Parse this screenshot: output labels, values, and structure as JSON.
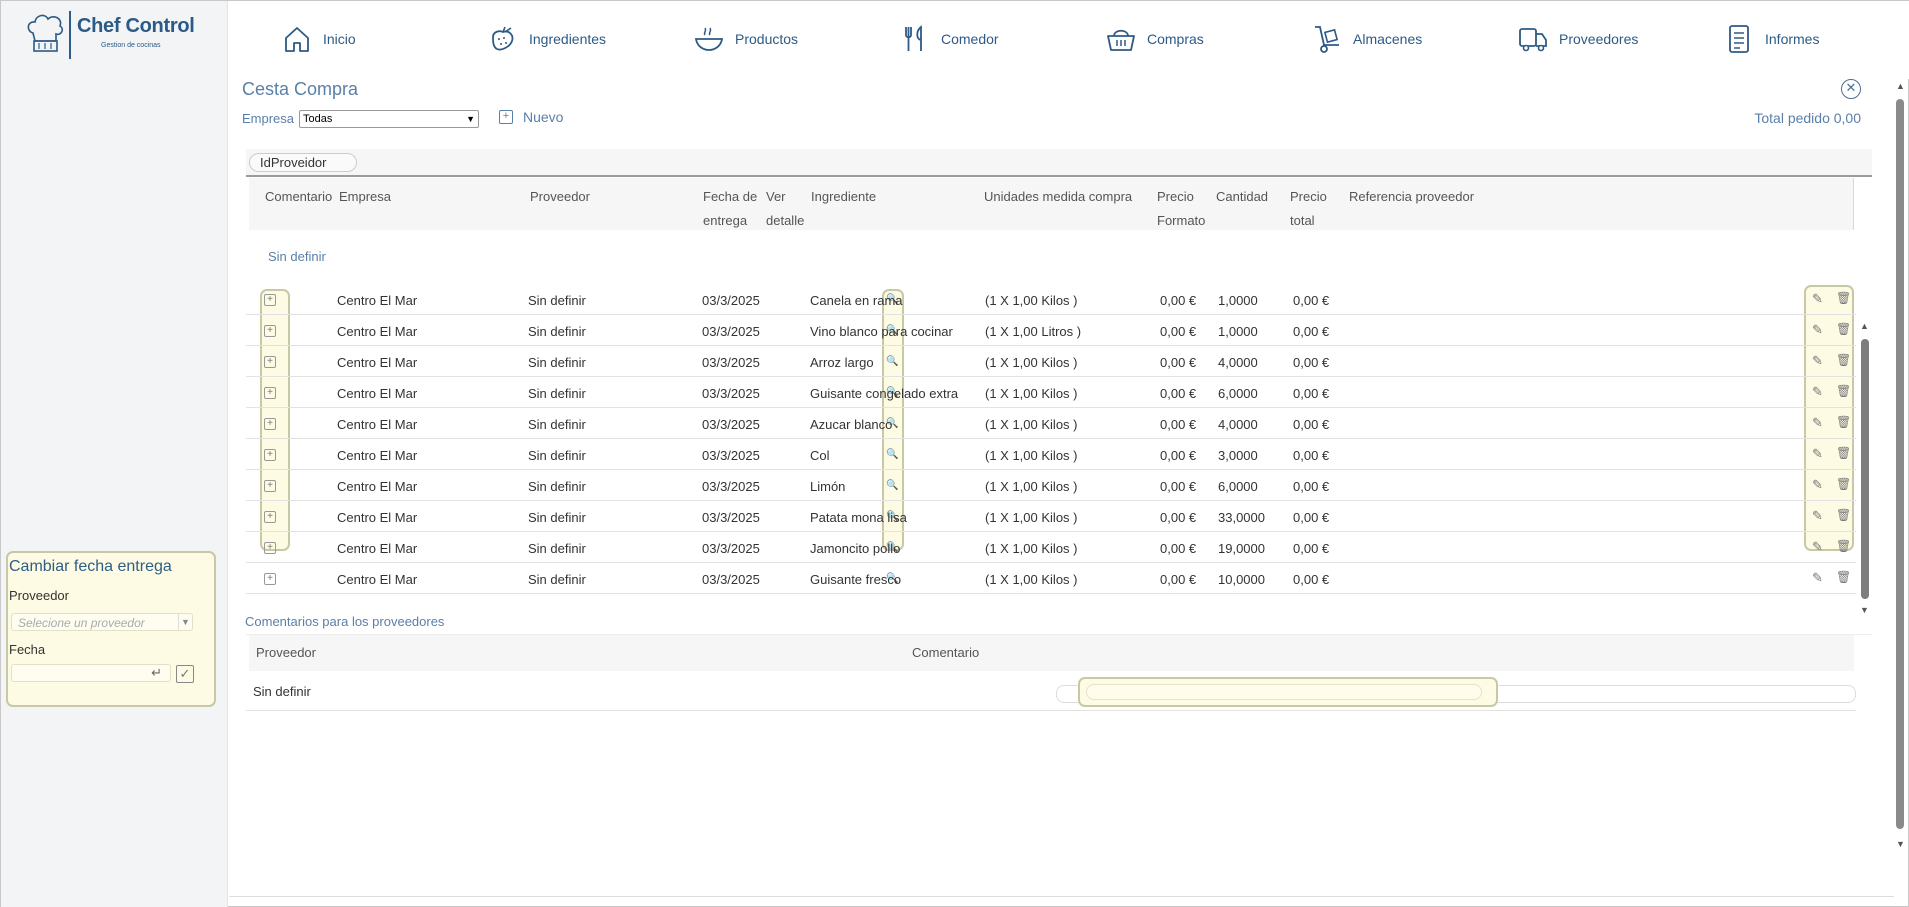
{
  "brand": {
    "title": "Chef Control",
    "subtitle": "Gestion de cocinas"
  },
  "nav": [
    {
      "label": "Inicio",
      "icon": "home-icon"
    },
    {
      "label": "Ingredientes",
      "icon": "strawberry-icon"
    },
    {
      "label": "Productos",
      "icon": "bowl-icon"
    },
    {
      "label": "Comedor",
      "icon": "cutlery-icon"
    },
    {
      "label": "Compras",
      "icon": "basket-icon"
    },
    {
      "label": "Almacenes",
      "icon": "hand-truck-icon"
    },
    {
      "label": "Proveedores",
      "icon": "truck-icon"
    },
    {
      "label": "Informes",
      "icon": "document-icon"
    }
  ],
  "page": {
    "title": "Cesta Compra",
    "empresa_label": "Empresa",
    "empresa_value": "Todas",
    "nuevo_label": "Nuevo",
    "total_label": "Total pedido 0,00"
  },
  "grid": {
    "group_chip": "IdProveidor",
    "group_name": "Sin definir",
    "headers": {
      "comentario": "Comentario",
      "empresa": "Empresa",
      "proveedor": "Proveedor",
      "fecha_1": "Fecha de",
      "fecha_2": "entrega",
      "ver_1": "Ver",
      "ver_2": "detalle",
      "ingrediente": "Ingrediente",
      "unidades": "Unidades medida compra",
      "precio_f_1": "Precio",
      "precio_f_2": "Formato",
      "cantidad": "Cantidad",
      "precio_t_1": "Precio",
      "precio_t_2": "total",
      "referencia": "Referencia proveedor"
    },
    "rows": [
      {
        "empresa": "Centro El Mar",
        "proveedor": "Sin definir",
        "fecha": "03/3/2025",
        "ingrediente": "Canela en rama",
        "unidades": "(1 X 1,00 Kilos )",
        "precio_formato": "0,00 €",
        "cantidad": "1,0000",
        "precio_total": "0,00 €"
      },
      {
        "empresa": "Centro El Mar",
        "proveedor": "Sin definir",
        "fecha": "03/3/2025",
        "ingrediente": "Vino blanco para cocinar",
        "unidades": "(1 X 1,00 Litros )",
        "precio_formato": "0,00 €",
        "cantidad": "1,0000",
        "precio_total": "0,00 €"
      },
      {
        "empresa": "Centro El Mar",
        "proveedor": "Sin definir",
        "fecha": "03/3/2025",
        "ingrediente": "Arroz largo",
        "unidades": "(1 X 1,00 Kilos )",
        "precio_formato": "0,00 €",
        "cantidad": "4,0000",
        "precio_total": "0,00 €"
      },
      {
        "empresa": "Centro El Mar",
        "proveedor": "Sin definir",
        "fecha": "03/3/2025",
        "ingrediente": "Guisante congelado extra",
        "unidades": "(1 X 1,00 Kilos )",
        "precio_formato": "0,00 €",
        "cantidad": "6,0000",
        "precio_total": "0,00 €"
      },
      {
        "empresa": "Centro El Mar",
        "proveedor": "Sin definir",
        "fecha": "03/3/2025",
        "ingrediente": "Azucar blanco",
        "unidades": "(1 X 1,00 Kilos )",
        "precio_formato": "0,00 €",
        "cantidad": "4,0000",
        "precio_total": "0,00 €"
      },
      {
        "empresa": "Centro El Mar",
        "proveedor": "Sin definir",
        "fecha": "03/3/2025",
        "ingrediente": "Col",
        "unidades": "(1 X 1,00 Kilos )",
        "precio_formato": "0,00 €",
        "cantidad": "3,0000",
        "precio_total": "0,00 €"
      },
      {
        "empresa": "Centro El Mar",
        "proveedor": "Sin definir",
        "fecha": "03/3/2025",
        "ingrediente": "Limón",
        "unidades": "(1 X 1,00 Kilos )",
        "precio_formato": "0,00 €",
        "cantidad": "6,0000",
        "precio_total": "0,00 €"
      },
      {
        "empresa": "Centro El Mar",
        "proveedor": "Sin definir",
        "fecha": "03/3/2025",
        "ingrediente": "Patata mona lisa",
        "unidades": "(1 X 1,00 Kilos )",
        "precio_formato": "0,00 €",
        "cantidad": "33,0000",
        "precio_total": "0,00 €"
      },
      {
        "empresa": "Centro El Mar",
        "proveedor": "Sin definir",
        "fecha": "03/3/2025",
        "ingrediente": "Jamoncito pollo",
        "unidades": "(1 X 1,00 Kilos )",
        "precio_formato": "0,00 €",
        "cantidad": "19,0000",
        "precio_total": "0,00 €"
      },
      {
        "empresa": "Centro El Mar",
        "proveedor": "Sin definir",
        "fecha": "03/3/2025",
        "ingrediente": "Guisante fresco",
        "unidades": "(1 X 1,00 Kilos )",
        "precio_formato": "0,00 €",
        "cantidad": "10,0000",
        "precio_total": "0,00 €"
      }
    ]
  },
  "comments": {
    "title": "Comentarios para los proveedores",
    "header_proveedor": "Proveedor",
    "header_comentario": "Comentario",
    "row_proveedor": "Sin definir"
  },
  "date_panel": {
    "title": "Cambiar fecha entrega",
    "proveedor_label": "Proveedor",
    "proveedor_placeholder": "Selecione un proveedor",
    "fecha_label": "Fecha"
  },
  "colors": {
    "brand": "#2c5a86",
    "accent": "#5a7fa8",
    "highlight": "#fdfbe3"
  }
}
